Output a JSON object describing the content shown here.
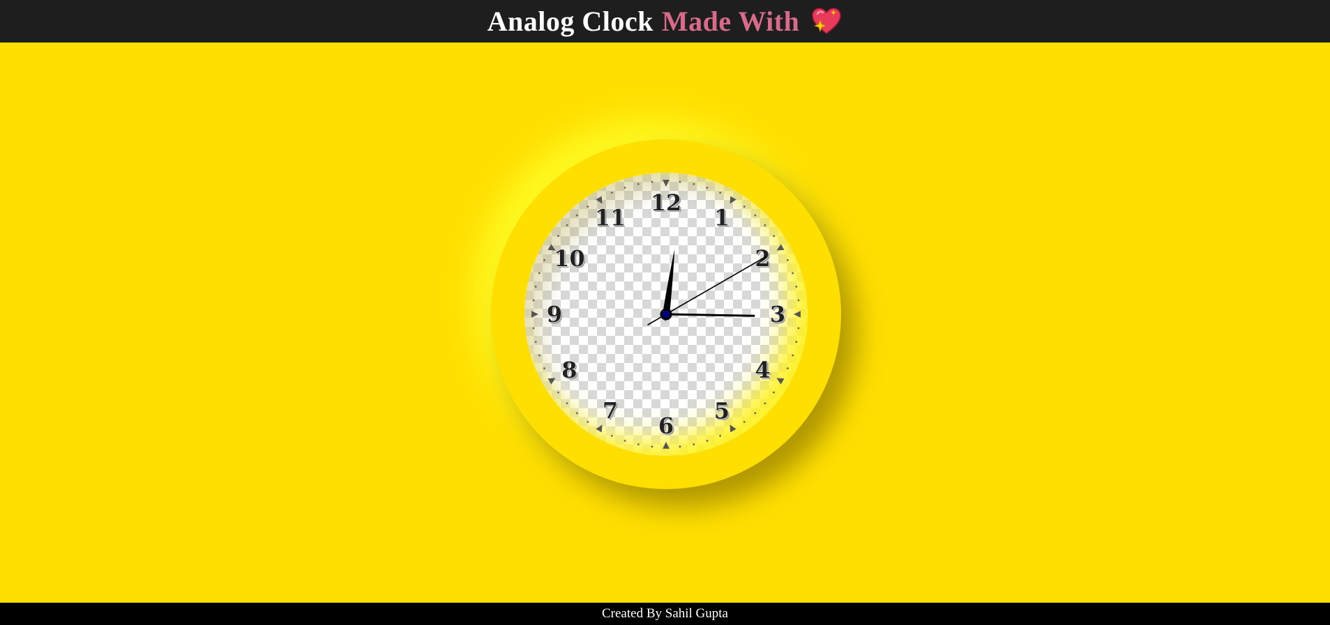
{
  "header": {
    "title_part1": "Analog Clock",
    "title_part2": "Made With",
    "icon": "sparkling-heart-icon",
    "accent_color": "#d86a8a",
    "bar_color": "#1e1e1e"
  },
  "clock": {
    "numerals": [
      "12",
      "1",
      "2",
      "3",
      "4",
      "5",
      "6",
      "7",
      "8",
      "9",
      "10",
      "11"
    ],
    "time": {
      "hour": 12,
      "minute": 15,
      "second": 10
    },
    "background_color": "#ffdf00",
    "hand_color": "#000000",
    "center_color": "#000080"
  },
  "footer": {
    "credit": "Created By Sahil Gupta"
  }
}
